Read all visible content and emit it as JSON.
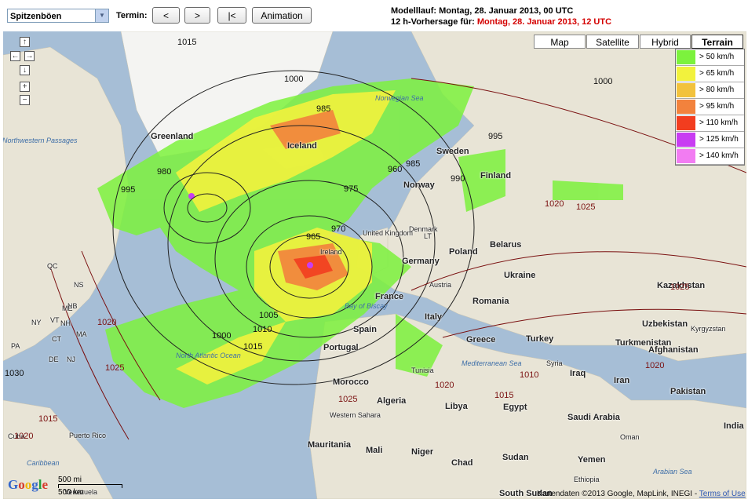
{
  "toolbar": {
    "parameter_select": "Spitzenböen",
    "termin_label": "Termin:",
    "prev_button": "<",
    "next_button": ">",
    "first_button": "|<",
    "animation_button": "Animation"
  },
  "run_info": {
    "model_run_prefix": "Modelllauf:",
    "model_run_value": "Montag, 28. Januar 2013, 00 UTC",
    "forecast_prefix": "12 h-Vorhersage für:",
    "forecast_value": "Montag, 28. Januar 2013, 12 UTC"
  },
  "map_types": {
    "map": "Map",
    "satellite": "Satellite",
    "hybrid": "Hybrid",
    "terrain": "Terrain",
    "active": "Terrain"
  },
  "legend": [
    {
      "label": "> 50 km/h",
      "color": "#7cf23d"
    },
    {
      "label": "> 65 km/h",
      "color": "#f2f23d"
    },
    {
      "label": "> 80 km/h",
      "color": "#f2c23d"
    },
    {
      "label": "> 95 km/h",
      "color": "#f2823d"
    },
    {
      "label": "> 110 km/h",
      "color": "#f23d1f"
    },
    {
      "label": "> 125 km/h",
      "color": "#c83df2"
    },
    {
      "label": "> 140 km/h",
      "color": "#f27cf2"
    }
  ],
  "nav": {
    "up": "↑",
    "left": "←",
    "right": "→",
    "down": "↓",
    "zoom_in": "+",
    "zoom_out": "−"
  },
  "countries": {
    "greenland": "Greenland",
    "iceland": "Iceland",
    "sweden": "Sweden",
    "finland": "Finland",
    "norway": "Norway",
    "denmark": "Denmark",
    "united_kingdom": "United Kingdom",
    "ireland": "Ireland",
    "germany": "Germany",
    "poland": "Poland",
    "belarus": "Belarus",
    "ukraine": "Ukraine",
    "austria": "Austria",
    "france": "France",
    "romania": "Romania",
    "kazakhstan": "Kazakhstan",
    "spain": "Spain",
    "italy": "Italy",
    "greece": "Greece",
    "turkey": "Turkey",
    "portugal": "Portugal",
    "uzbekistan": "Uzbekistan",
    "kyrgyzstan": "Kyrgyzstan",
    "turkmenistan": "Turkmenistan",
    "afghanistan": "Afghanistan",
    "pakistan": "Pakistan",
    "iran": "Iran",
    "iraq": "Iraq",
    "syria": "Syria",
    "morocco": "Morocco",
    "algeria": "Algeria",
    "tunisia": "Tunisia",
    "libya": "Libya",
    "egypt": "Egypt",
    "saudi_arabia": "Saudi Arabia",
    "oman": "Oman",
    "yemen": "Yemen",
    "western_sahara": "Western Sahara",
    "mauritania": "Mauritania",
    "mali": "Mali",
    "niger": "Niger",
    "chad": "Chad",
    "sudan": "Sudan",
    "ethiopia": "Ethiopia",
    "south_sudan": "South Sudan",
    "arabian_sea": "Arabian Sea",
    "india": "India",
    "puerto_rico": "Puerto Rico",
    "cuba": "Cuba",
    "venezuela": "Venezuela",
    "caribbean": "Caribbean",
    "northwestern_passages": "Northwestern Passages",
    "mediterranean": "Mediterranean Sea",
    "norwegian_sea": "Norwegian Sea",
    "north_atlantic": "North Atlantic Ocean",
    "bay_of_biscay": "Bay of Biscay",
    "ns": "NS",
    "nb": "NB",
    "me": "ME",
    "ny": "NY",
    "pa": "PA",
    "ct": "CT",
    "nj": "NJ",
    "de": "DE",
    "ma": "MA",
    "vt": "VT",
    "qc": "QC",
    "nh": "NH",
    "lt": "LT"
  },
  "isobars": {
    "i1015_top": "1015",
    "i1000_n": "1000",
    "i985_ice": "985",
    "i995_w": "995",
    "i980_gl": "980",
    "i990_fin": "990",
    "i995_fin": "995",
    "i960_no": "960",
    "i985_no": "985",
    "i975": "975",
    "i965": "965",
    "i970": "970",
    "i1000_ne": "1000",
    "i1020_e": "1020",
    "i1025_e": "1025",
    "i1025_w": "1025",
    "i1020_w": "1020",
    "i1005": "1005",
    "i1010": "1010",
    "i1000_s": "1000",
    "i1015_s": "1015",
    "i1025_af": "1025",
    "i1020_med": "1020",
    "i1015_eg": "1015",
    "i1010_me": "1010",
    "i1015_ca": "1015",
    "i1020_car": "1020",
    "i1030": "1030",
    "i1020_ire": "1020",
    "i1025_kz": "1025"
  },
  "footer": {
    "google": "Google",
    "scale_mi": "500 mi",
    "scale_km": "500 km",
    "map_data": "Kartendaten ©2013 Google, MapLink, INEGI -",
    "terms": "Terms of Use"
  }
}
